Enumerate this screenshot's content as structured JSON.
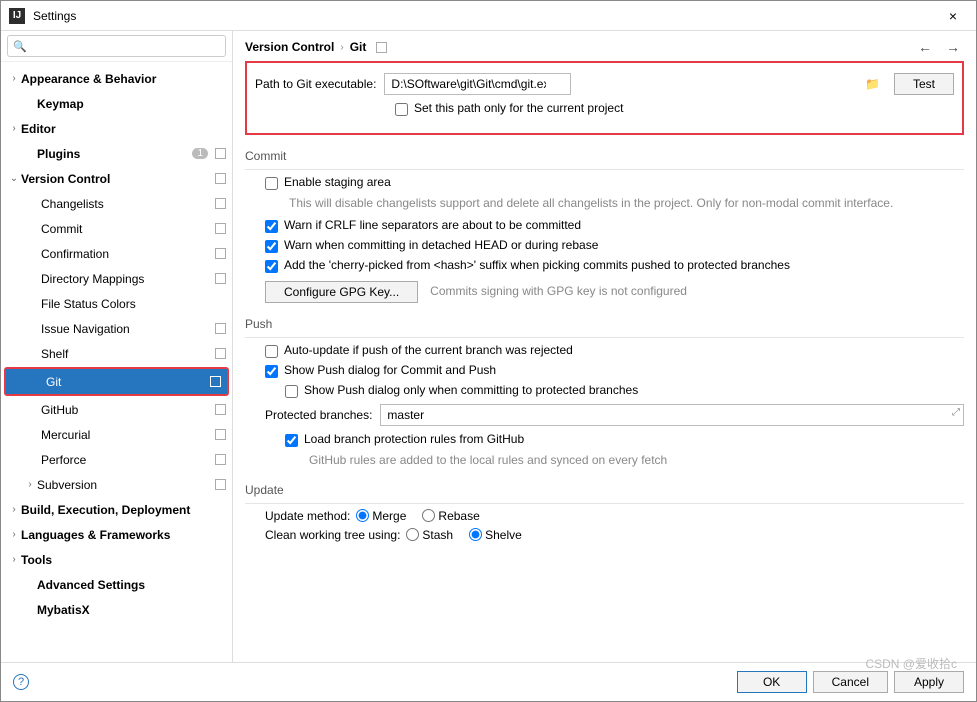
{
  "window": {
    "title": "Settings",
    "close": "×"
  },
  "search": {
    "placeholder": ""
  },
  "tree": {
    "appearance": "Appearance & Behavior",
    "keymap": "Keymap",
    "editor": "Editor",
    "plugins": "Plugins",
    "plugins_badge": "1",
    "version_control": "Version Control",
    "changelists": "Changelists",
    "commit": "Commit",
    "confirmation": "Confirmation",
    "directory_mappings": "Directory Mappings",
    "file_status_colors": "File Status Colors",
    "issue_navigation": "Issue Navigation",
    "shelf": "Shelf",
    "git": "Git",
    "github": "GitHub",
    "mercurial": "Mercurial",
    "perforce": "Perforce",
    "subversion": "Subversion",
    "build": "Build, Execution, Deployment",
    "languages": "Languages & Frameworks",
    "tools": "Tools",
    "advanced": "Advanced Settings",
    "mybatisx": "MybatisX"
  },
  "crumb": {
    "vc": "Version Control",
    "git": "Git"
  },
  "path": {
    "label": "Path to Git executable:",
    "value": "D:\\SOftware\\git\\Git\\cmd\\git.exe",
    "test": "Test",
    "only_project": "Set this path only for the current project"
  },
  "commit": {
    "title": "Commit",
    "enable_staging": "Enable staging area",
    "staging_hint": "This will disable changelists support and delete all changelists in the project. Only for non-modal commit interface.",
    "warn_crlf": "Warn if CRLF line separators are about to be committed",
    "warn_detached": "Warn when committing in detached HEAD or during rebase",
    "cherry": "Add the 'cherry-picked from <hash>' suffix when picking commits pushed to protected branches",
    "gpg_btn": "Configure GPG Key...",
    "gpg_hint": "Commits signing with GPG key is not configured"
  },
  "push": {
    "title": "Push",
    "auto_update": "Auto-update if push of the current branch was rejected",
    "show_dialog": "Show Push dialog for Commit and Push",
    "show_dialog_protected": "Show Push dialog only when committing to protected branches",
    "protected_label": "Protected branches:",
    "protected_value": "master",
    "load_rules": "Load branch protection rules from GitHub",
    "load_rules_hint": "GitHub rules are added to the local rules and synced on every fetch"
  },
  "update": {
    "title": "Update",
    "method_label": "Update method:",
    "merge": "Merge",
    "rebase": "Rebase",
    "clean_label": "Clean working tree using:",
    "stash": "Stash",
    "shelve": "Shelve"
  },
  "footer": {
    "ok": "OK",
    "cancel": "Cancel",
    "apply": "Apply"
  },
  "watermark": "CSDN @爱收拾c"
}
